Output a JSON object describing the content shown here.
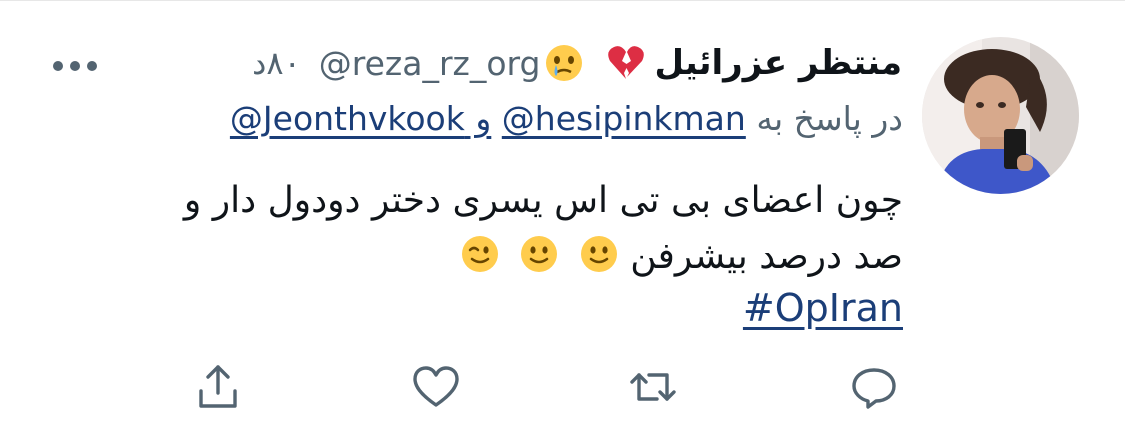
{
  "tweet": {
    "author_name": "منتظر عزرائیل",
    "author_emojis": [
      "broken-heart-emoji",
      "face-holding-back-tears-emoji"
    ],
    "handle": "@reza_rz_org",
    "time": "۸۰د",
    "more_icon": "more-icon",
    "reply_prefix": "در پاسخ به",
    "reply_mention_1": "@hesipinkman",
    "reply_conjunction": " و ",
    "reply_mention_2": "@Jeonthvkook",
    "body_line_1": "چون اعضای بی تی اس یسری دختر دودول دار و",
    "body_line_2": "صد درصد بیشرفن",
    "body_emojis": [
      "slightly-smiling-face-emoji",
      "slightly-smiling-face-emoji",
      "winking-face-emoji"
    ],
    "hashtag": "#OpIran"
  },
  "actions": {
    "reply_icon": "reply-icon",
    "retweet_icon": "retweet-icon",
    "like_icon": "heart-icon",
    "share_icon": "share-icon"
  },
  "colors": {
    "text": "#0f1419",
    "secondary": "#536471",
    "link": "#1b3e78",
    "icon": "#536471"
  }
}
